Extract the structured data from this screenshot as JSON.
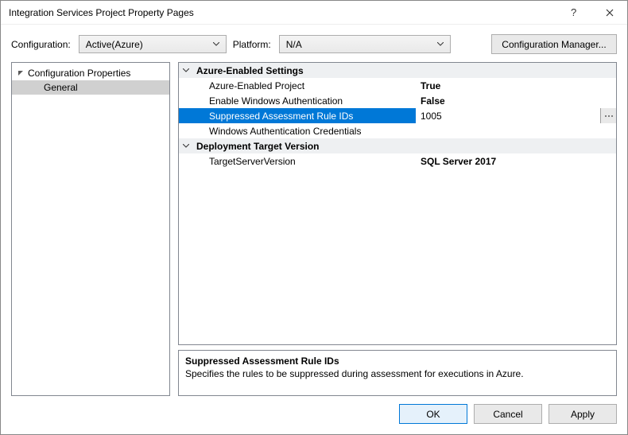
{
  "window": {
    "title": "Integration Services Project Property Pages"
  },
  "configRow": {
    "configuration_label": "Configuration:",
    "configuration_value": "Active(Azure)",
    "platform_label": "Platform:",
    "platform_value": "N/A",
    "config_manager_label": "Configuration Manager..."
  },
  "tree": {
    "root": "Configuration Properties",
    "child": "General"
  },
  "grid": {
    "cat1": "Azure-Enabled Settings",
    "props1": [
      {
        "name": "Azure-Enabled Project",
        "value": "True",
        "bold": true
      },
      {
        "name": "Enable Windows Authentication",
        "value": "False",
        "bold": true
      },
      {
        "name": "Suppressed Assessment Rule IDs",
        "value": "1005",
        "bold": false,
        "selected": true,
        "ellipsis": true
      },
      {
        "name": "Windows Authentication Credentials",
        "value": "",
        "bold": false
      }
    ],
    "cat2": "Deployment Target Version",
    "props2": [
      {
        "name": "TargetServerVersion",
        "value": "SQL Server 2017",
        "bold": true
      }
    ]
  },
  "desc": {
    "title": "Suppressed Assessment Rule IDs",
    "body": "Specifies the rules to be suppressed during assessment for executions in Azure."
  },
  "footer": {
    "ok": "OK",
    "cancel": "Cancel",
    "apply": "Apply"
  }
}
